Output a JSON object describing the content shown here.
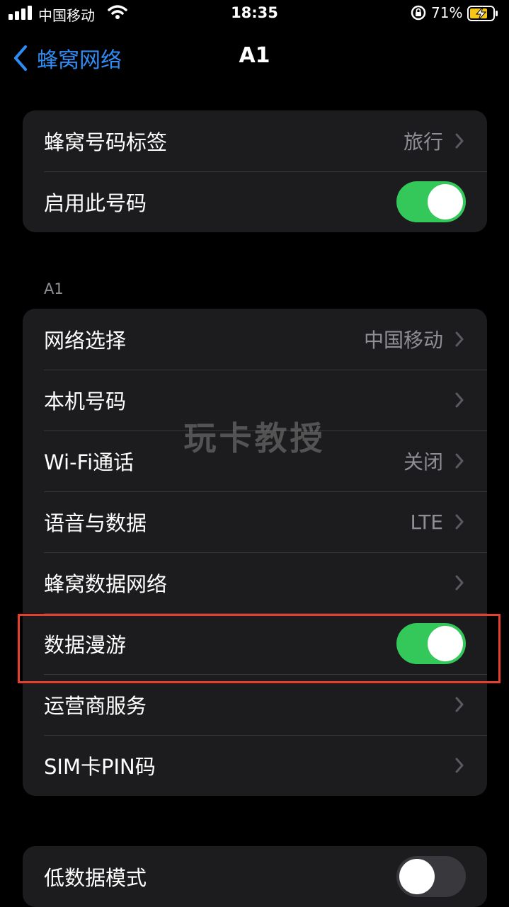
{
  "status_bar": {
    "carrier": "中国移动",
    "time": "18:35",
    "battery_percent": "71%"
  },
  "nav": {
    "back_label": "蜂窝网络",
    "title": "A1"
  },
  "group1": {
    "rows": [
      {
        "label": "蜂窝号码标签",
        "value": "旅行"
      },
      {
        "label": "启用此号码",
        "toggle": true
      }
    ]
  },
  "section_header": "A1",
  "group2": {
    "rows": [
      {
        "label": "网络选择",
        "value": "中国移动"
      },
      {
        "label": "本机号码",
        "value": ""
      },
      {
        "label": "Wi-Fi通话",
        "value": "关闭"
      },
      {
        "label": "语音与数据",
        "value": "LTE"
      },
      {
        "label": "蜂窝数据网络",
        "value": ""
      },
      {
        "label": "数据漫游",
        "toggle": true
      },
      {
        "label": "运营商服务",
        "value": ""
      },
      {
        "label": "SIM卡PIN码",
        "value": ""
      }
    ]
  },
  "group3": {
    "rows": [
      {
        "label": "低数据模式",
        "toggle": false
      }
    ]
  },
  "watermark": "玩卡教授",
  "colors": {
    "accent": "#2f8cf5",
    "toggle_on": "#34c759",
    "highlight": "#e5402e"
  }
}
